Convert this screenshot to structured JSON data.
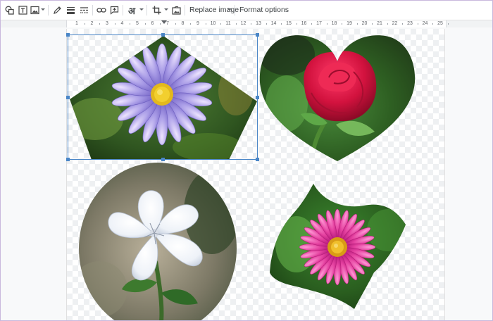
{
  "toolbar": {
    "icons": [
      "shape-icon",
      "text-box-icon",
      "image-icon",
      "pen-icon",
      "line-weight-icon",
      "line-dash-icon",
      "link-icon",
      "comment-icon",
      "input-tools-icon",
      "crop-icon",
      "reset-image-icon"
    ],
    "input_tools_glyph": "अ",
    "replace_image_label": "Replace image",
    "format_options_label": "Format options"
  },
  "ruler": {
    "numbers": [
      "1",
      "2",
      "3",
      "4",
      "5",
      "6",
      "7",
      "8",
      "9",
      "10",
      "11",
      "12",
      "13",
      "14",
      "15",
      "16",
      "17",
      "18",
      "19",
      "20",
      "21",
      "22",
      "23",
      "24",
      "25"
    ]
  },
  "canvas": {
    "images": [
      {
        "name": "purple-aster",
        "shape": "pentagon",
        "selected": true
      },
      {
        "name": "red-rose",
        "shape": "heart",
        "selected": false
      },
      {
        "name": "white-flower",
        "shape": "oval",
        "selected": false
      },
      {
        "name": "pink-aster",
        "shape": "wave-flag",
        "selected": false
      }
    ]
  },
  "colors": {
    "selection": "#4a86c7",
    "toolbar_icon": "#444444"
  }
}
